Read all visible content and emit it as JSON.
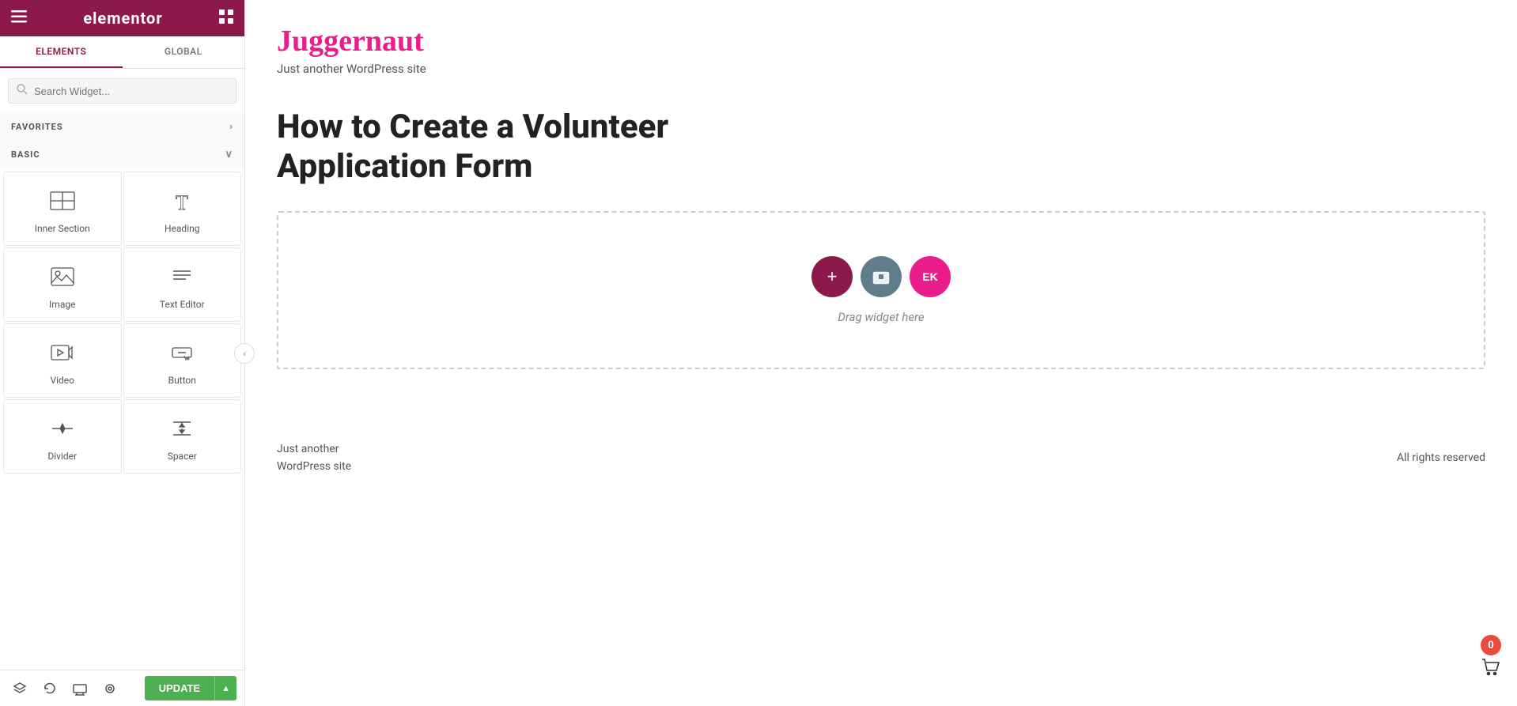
{
  "header": {
    "logo_text": "elementor",
    "hamburger_label": "☰",
    "grid_label": "⊞"
  },
  "tabs": {
    "elements_label": "ELEMENTS",
    "global_label": "GLOBAL"
  },
  "search": {
    "placeholder": "Search Widget..."
  },
  "favorites": {
    "label": "FAVORITES",
    "chevron": "›"
  },
  "basic": {
    "label": "BASIC",
    "chevron": "∨"
  },
  "widgets": [
    {
      "id": "inner-section",
      "label": "Inner Section"
    },
    {
      "id": "heading",
      "label": "Heading"
    },
    {
      "id": "image",
      "label": "Image"
    },
    {
      "id": "text-editor",
      "label": "Text Editor"
    },
    {
      "id": "video",
      "label": "Video"
    },
    {
      "id": "button",
      "label": "Button"
    },
    {
      "id": "divider",
      "label": "Divider"
    },
    {
      "id": "spacer",
      "label": "Spacer"
    }
  ],
  "toolbar": {
    "update_label": "UPDATE",
    "update_arrow": "▲"
  },
  "site": {
    "logo": "Juggernaut",
    "tagline": "Just another WordPress site",
    "page_title": "How to Create a Volunteer Application Form",
    "drop_text": "Drag widget here",
    "footer_left_line1": "Just another",
    "footer_left_line2": "WordPress site",
    "footer_right": "All rights reserved",
    "cart_count": "0"
  },
  "drop_buttons": {
    "add_label": "+",
    "folder_label": "▣",
    "ek_label": "EK"
  }
}
